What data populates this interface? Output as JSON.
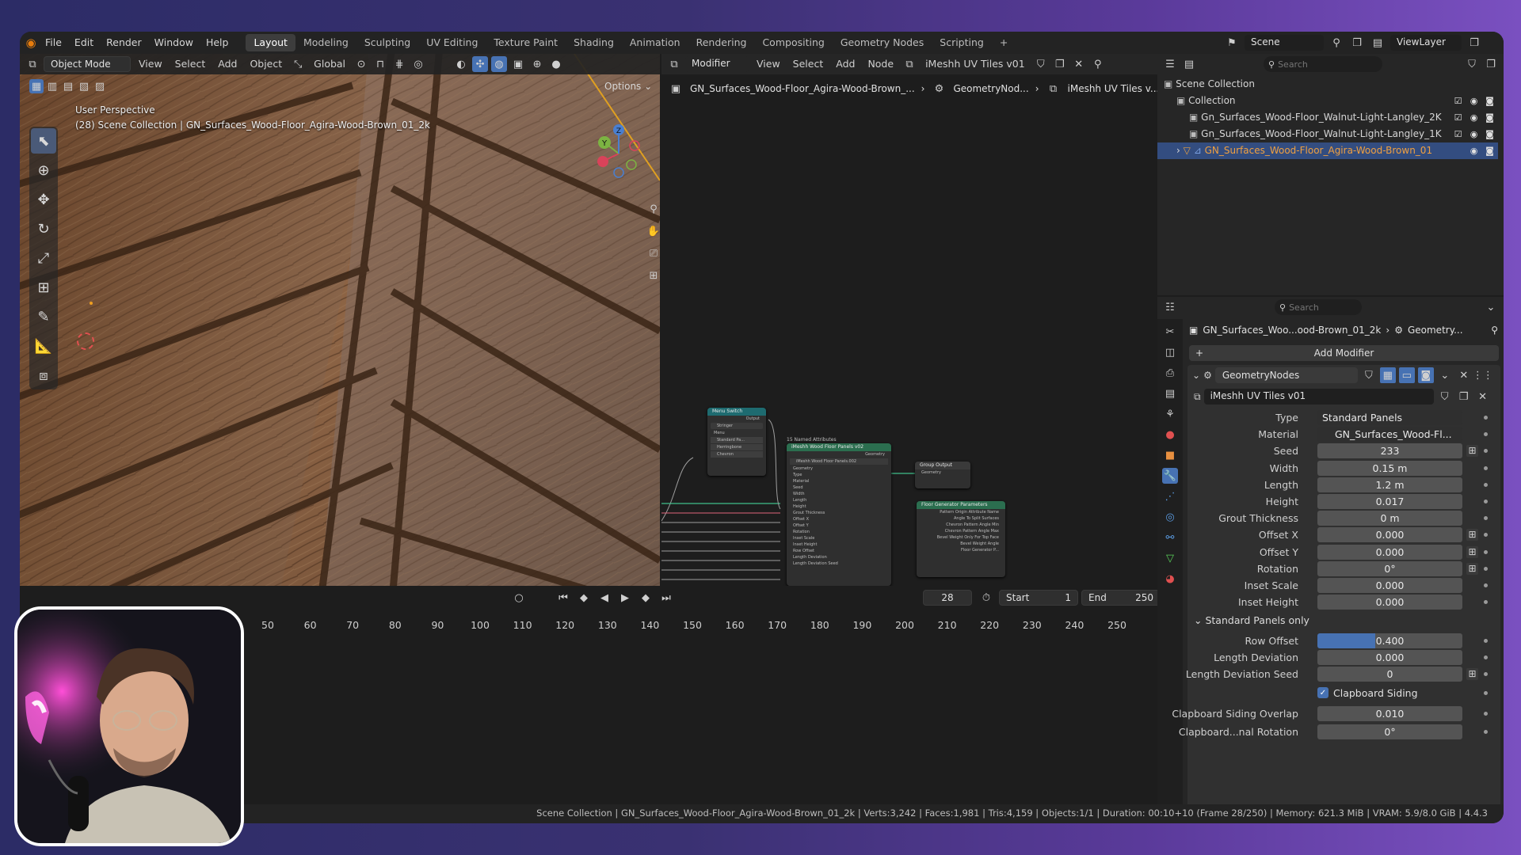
{
  "topmenu": {
    "items": [
      "File",
      "Edit",
      "Render",
      "Window",
      "Help"
    ],
    "workspaces": [
      "Layout",
      "Modeling",
      "Sculpting",
      "UV Editing",
      "Texture Paint",
      "Shading",
      "Animation",
      "Rendering",
      "Compositing",
      "Geometry Nodes",
      "Scripting"
    ],
    "active_workspace": "Layout",
    "add_tab": "+",
    "scene_name": "Scene",
    "view_layer": "ViewLayer"
  },
  "viewport": {
    "mode": "Object Mode",
    "menus": [
      "View",
      "Select",
      "Add",
      "Object"
    ],
    "orientation": "Global",
    "options_label": "Options",
    "overlay_line1": "User Perspective",
    "overlay_line2": "(28) Scene Collection | GN_Surfaces_Wood-Floor_Agira-Wood-Brown_01_2k",
    "gizmo": {
      "x": "X",
      "y": "Y",
      "z": "Z"
    }
  },
  "node_editor": {
    "editor_type": "Modifier",
    "menus": [
      "View",
      "Select",
      "Add",
      "Node"
    ],
    "node_group": "iMeshh UV Tiles v01",
    "breadcrumb": [
      "GN_Surfaces_Wood-Floor_Agira-Wood-Brown_...",
      "GeometryNod...",
      "iMeshh UV Tiles v..."
    ],
    "nodes": {
      "menu_switch": {
        "title": "Menu Switch",
        "output": "Output",
        "menu": "Stringer",
        "rows": [
          "Menu",
          "Standard Pa...",
          "Herringbone",
          "Chevron"
        ]
      },
      "main": {
        "title": "iMeshh Wood Floor Panels v02",
        "group": "iMeshh Wood Floor Panels.002",
        "header": "15 Named Attributes",
        "inputs": [
          "Geometry",
          "Type",
          "Material",
          "Seed",
          "Width",
          "Length",
          "Height",
          "Grout Thickness",
          "Offset X",
          "Offset Y",
          "Rotation",
          "Inset Scale",
          "Inset Height",
          "Row Offset",
          "Length Deviation",
          "Length Deviation Seed"
        ],
        "output": "Geometry"
      },
      "group_output": {
        "title": "Group Output",
        "rows": [
          "Geometry"
        ]
      },
      "pattern": {
        "title": "Floor Generator Parameters",
        "rows": [
          "Pattern Origin Attribute Name",
          "Angle To Split Surfaces",
          "Chevron Pattern Angle Min",
          "Chevron Pattern Angle Max",
          "Bevel Weight Only For Top Face",
          "Bevel Weight Angle",
          "Floor Generator P..."
        ]
      }
    }
  },
  "timeline": {
    "frames": [
      "50",
      "60",
      "70",
      "80",
      "90",
      "100",
      "110",
      "120",
      "130",
      "140",
      "150",
      "160",
      "170",
      "180",
      "190",
      "200",
      "210",
      "220",
      "230",
      "240",
      "250"
    ],
    "current_frame": "28",
    "start_label": "Start",
    "start": "1",
    "end_label": "End",
    "end": "250"
  },
  "statusbar": {
    "text": "Scene Collection | GN_Surfaces_Wood-Floor_Agira-Wood-Brown_01_2k | Verts:3,242 | Faces:1,981 | Tris:4,159 | Objects:1/1 | Duration: 00:10+10 (Frame 28/250) | Memory: 621.3 MiB | VRAM: 5.9/8.0 GiB | 4.4.3"
  },
  "outliner": {
    "search_placeholder": "Search",
    "root": "Scene Collection",
    "rows": [
      "Collection",
      "Gn_Surfaces_Wood-Floor_Walnut-Light-Langley_2K",
      "Gn_Surfaces_Wood-Floor_Walnut-Light-Langley_1K",
      "GN_Surfaces_Wood-Floor_Agira-Wood-Brown_01"
    ]
  },
  "properties": {
    "search_placeholder": "Search",
    "object_name": "GN_Surfaces_Woo...ood-Brown_01_2k",
    "breadcrumb_tail": "Geometry...",
    "add_modifier": "Add Modifier",
    "modifier_name": "GeometryNodes",
    "node_group": "iMeshh UV Tiles v01",
    "fields": [
      {
        "label": "Type",
        "value": "Standard Panels"
      },
      {
        "label": "Material",
        "value": "GN_Surfaces_Wood-Fl..."
      },
      {
        "label": "Seed",
        "value": "233"
      },
      {
        "label": "Width",
        "value": "0.15 m"
      },
      {
        "label": "Length",
        "value": "1.2 m"
      },
      {
        "label": "Height",
        "value": "0.017"
      },
      {
        "label": "Grout Thickness",
        "value": "0 m"
      },
      {
        "label": "Offset X",
        "value": "0.000"
      },
      {
        "label": "Offset Y",
        "value": "0.000"
      },
      {
        "label": "Rotation",
        "value": "0°"
      },
      {
        "label": "Inset Scale",
        "value": "0.000"
      },
      {
        "label": "Inset Height",
        "value": "0.000"
      }
    ],
    "subpanel": "Standard Panels only",
    "subfields": [
      {
        "label": "Row Offset",
        "value": "0.400",
        "fill": 0.4
      },
      {
        "label": "Length Deviation",
        "value": "0.000"
      },
      {
        "label": "Length Deviation Seed",
        "value": "0"
      }
    ],
    "checkbox_label": "Clapboard Siding",
    "checkbox_checked": true,
    "overlap_label": "Clapboard Siding Overlap",
    "overlap_value": "0.010",
    "cut_label": "Clapboard...nal Rotation",
    "cut_value": "0°"
  },
  "colors": {
    "accent": "#4772b3",
    "selected_row": "#334d80",
    "node_green": "#2b6e4f",
    "node_teal": "#1e6b70"
  }
}
